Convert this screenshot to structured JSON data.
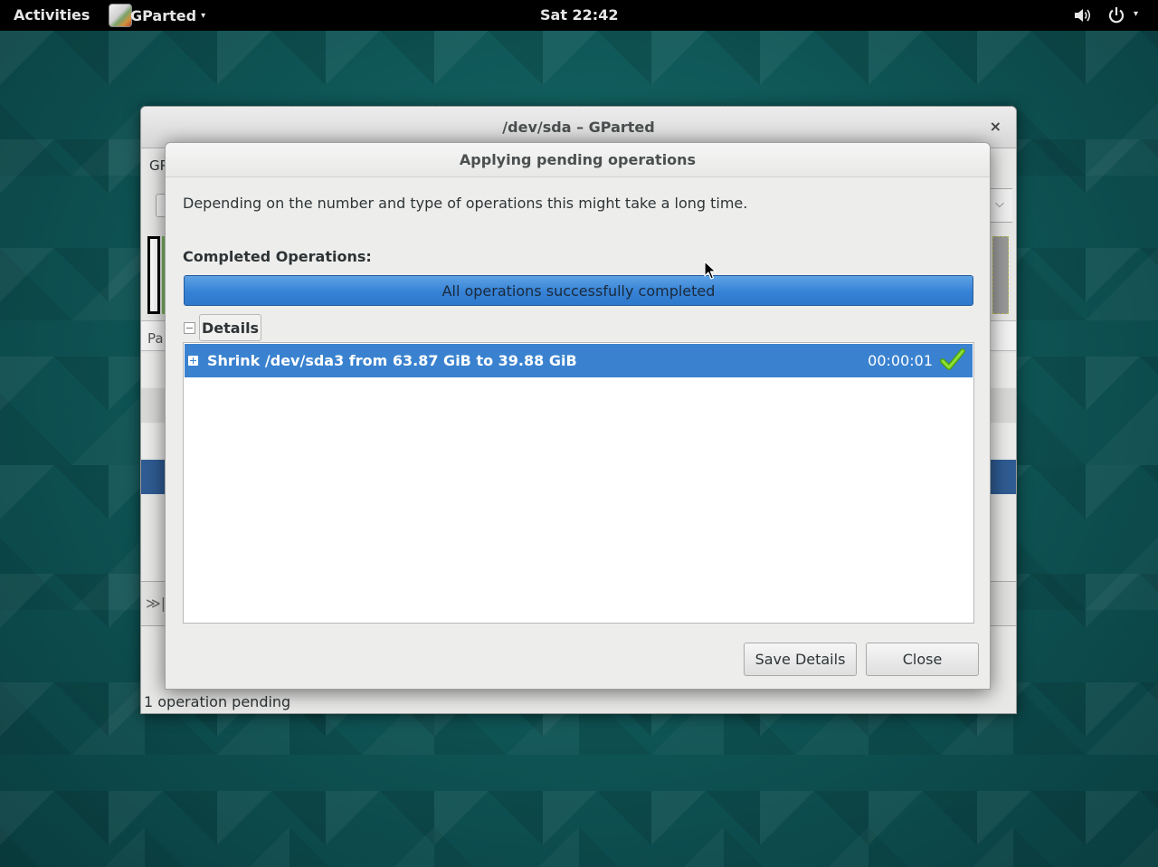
{
  "topbar": {
    "activities": "Activities",
    "app_name": "GParted",
    "app_menu_arrow": "▾",
    "clock": "Sat 22:42",
    "system_arrow": "▾"
  },
  "main_window": {
    "title": "/dev/sda – GParted",
    "close_glyph": "×",
    "menubar_fragment": "GP",
    "device_combo_arrow": "⌵",
    "list_header_fragment": "Pa",
    "ops_icon_glyph": "≫|",
    "status": "1 operation pending"
  },
  "dialog": {
    "title": "Applying pending operations",
    "description": "Depending on the number and type of operations this might take a long time.",
    "completed_label": "Completed Operations:",
    "progress_text": "All operations successfully completed",
    "progress_fraction": 1.0,
    "details_label": "Details",
    "operations": [
      {
        "label": "Shrink /dev/sda3 from 63.87 GiB to 39.88 GiB",
        "time": "00:00:01",
        "status_icon": "check-icon"
      }
    ],
    "buttons": {
      "save_details": "Save Details",
      "close": "Close"
    }
  },
  "colors": {
    "selection": "#3a82cf",
    "progress": "#3682d6",
    "success": "#73d216"
  }
}
